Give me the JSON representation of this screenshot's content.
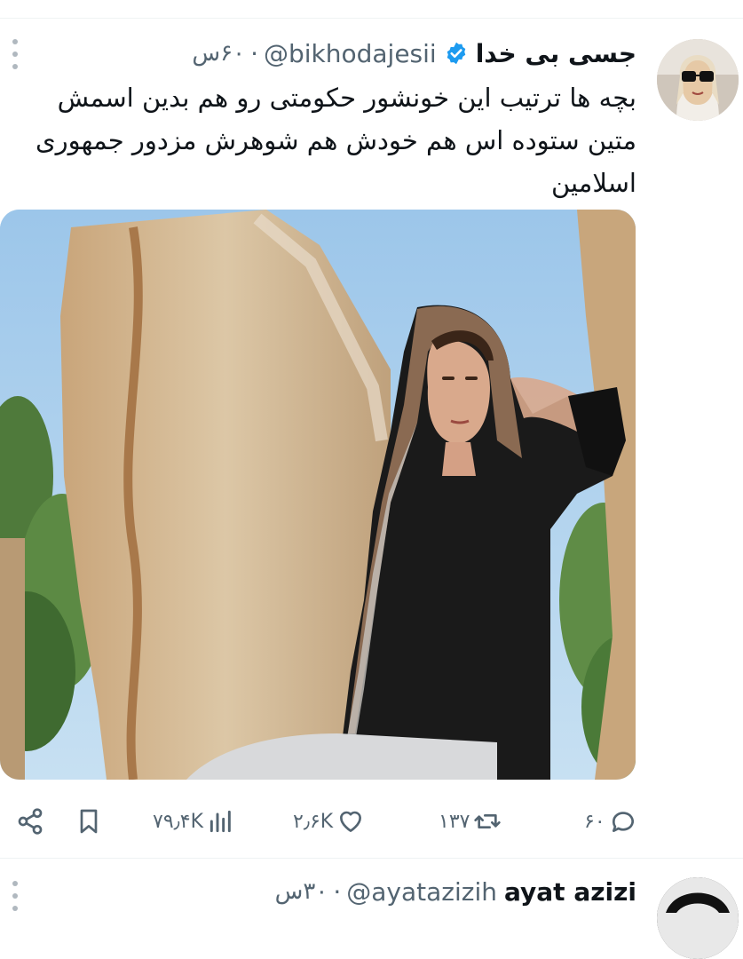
{
  "tweet": {
    "display_name": "جسی بی خدا",
    "handle": "@bikhodajesii",
    "separator": "·",
    "time": "۶۰س",
    "text": "بچه ها ترتیب این خونشور حکومتی رو هم بدین اسمش متین ستوده اس هم خودش هم شوهرش مزدور جمهوری اسلامین",
    "verified": true,
    "actions": {
      "replies": "۶۰",
      "retweets": "۱۳۷",
      "likes": "۲٫۶K",
      "views": "۷۹٫۴K"
    }
  },
  "next_tweet": {
    "display_name": "ayat azizi",
    "handle": "@ayatazizih",
    "separator": "·",
    "time": "۳۰س"
  },
  "colors": {
    "text": "#0f1419",
    "secondary": "#536471",
    "verified": "#1d9bf0",
    "divider": "#eff3f4"
  },
  "icons": [
    "more-icon",
    "verified-badge-icon",
    "share-icon",
    "bookmark-icon",
    "views-icon",
    "like-icon",
    "retweet-icon",
    "reply-icon"
  ]
}
